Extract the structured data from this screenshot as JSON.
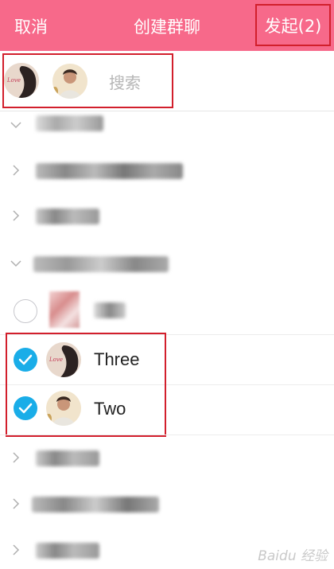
{
  "header": {
    "cancel_label": "取消",
    "title": "创建群聊",
    "start_label": "发起(2)",
    "background": "#f7698a"
  },
  "search": {
    "placeholder": "搜索",
    "selected_avatars": [
      "avatar-three",
      "avatar-two"
    ]
  },
  "groups": [
    {
      "state": "expanded",
      "label": "[blurred]"
    },
    {
      "state": "collapsed",
      "label": "[blurred]"
    },
    {
      "state": "collapsed",
      "label": "[blurred]"
    },
    {
      "state": "expanded",
      "label": "[blurred]"
    }
  ],
  "contacts": [
    {
      "name": "",
      "checked": false
    },
    {
      "name": "Three",
      "checked": true
    },
    {
      "name": "Two",
      "checked": true
    }
  ],
  "groups_bottom": [
    {
      "state": "collapsed",
      "label": "[blurred]"
    },
    {
      "state": "collapsed",
      "label": "[blurred]"
    },
    {
      "state": "collapsed",
      "label": "[blurred]"
    }
  ],
  "watermark": "Baidu 经验",
  "colors": {
    "accent": "#f7698a",
    "check": "#1aade8",
    "highlight_box": "#d21f2c"
  }
}
